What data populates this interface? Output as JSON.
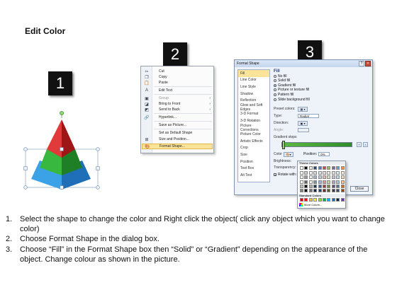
{
  "title": "Edit Color",
  "badges": [
    "1",
    "2",
    "3"
  ],
  "colors": {
    "pyramid_top": "#d42a2a",
    "pyramid_middle": "#2fa836",
    "pyramid_bottom": "#2f8fd6",
    "menu_highlight": "#fbe49a",
    "gradient_start": "#5db844",
    "gradient_end": "#2f8d2a"
  },
  "context_menu": {
    "items": [
      {
        "label": "Cut",
        "icon": "scissors-icon",
        "enabled": true
      },
      {
        "label": "Copy",
        "icon": "copy-icon",
        "enabled": true
      },
      {
        "label": "Paste",
        "icon": "paste-icon",
        "enabled": true
      },
      {
        "label": "Edit Text",
        "icon": "edit-text-icon",
        "enabled": true
      },
      {
        "label": "Group",
        "icon": "group-icon",
        "enabled": false,
        "submenu": true
      },
      {
        "label": "Bring to Front",
        "icon": "bring-front-icon",
        "enabled": true,
        "submenu": true
      },
      {
        "label": "Send to Back",
        "icon": "send-back-icon",
        "enabled": true,
        "submenu": true
      },
      {
        "label": "Hyperlink...",
        "icon": "hyperlink-icon",
        "enabled": true
      },
      {
        "label": "Save as Picture...",
        "icon": "",
        "enabled": true
      },
      {
        "label": "Set as Default Shape",
        "icon": "",
        "enabled": true
      },
      {
        "label": "Size and Position...",
        "icon": "size-position-icon",
        "enabled": true
      },
      {
        "label": "Format Shape...",
        "icon": "format-shape-icon",
        "enabled": true,
        "highlighted": true
      }
    ]
  },
  "dialog": {
    "title": "Format Shape",
    "help": "?",
    "close_glyph": "×",
    "categories": [
      "Fill",
      "Line Color",
      "Line Style",
      "Shadow",
      "Reflection",
      "Glow and Soft Edges",
      "3-D Format",
      "3-D Rotation",
      "Picture Corrections",
      "Picture Color",
      "Artistic Effects",
      "Crop",
      "Size",
      "Position",
      "Text Box",
      "Alt Text"
    ],
    "selected_category": "Fill",
    "heading": "Fill",
    "fill_options": [
      {
        "label": "No fill",
        "checked": false
      },
      {
        "label": "Solid fill",
        "checked": false
      },
      {
        "label": "Gradient fill",
        "checked": true
      },
      {
        "label": "Picture or texture fill",
        "checked": false
      },
      {
        "label": "Pattern fill",
        "checked": false
      },
      {
        "label": "Slide background fill",
        "checked": false
      }
    ],
    "preset_colors_label": "Preset colors:",
    "type_label": "Type:",
    "type_value": "Radial",
    "direction_label": "Direction:",
    "angle_label": "Angle:",
    "gradient_stops_label": "Gradient stops",
    "color_label": "Color",
    "position_label": "Position:",
    "position_value": "0%",
    "brightness_label": "Brightness:",
    "transparency_label": "Transparency:",
    "rotate_label": "Rotate with shape",
    "close_label": "Close"
  },
  "picker": {
    "theme_label": "Theme Colors",
    "standard_label": "Standard Colors",
    "more_label": "More Colors...",
    "theme_top": [
      "#ffffff",
      "#000000",
      "#eeece1",
      "#1f497d",
      "#4f81bd",
      "#c0504d",
      "#9bbb59",
      "#8064a2",
      "#4bacc6",
      "#f79646"
    ],
    "standard": [
      "#c00000",
      "#ff0000",
      "#ffc000",
      "#ffff00",
      "#92d050",
      "#00b050",
      "#00b0f0",
      "#0070c0",
      "#002060",
      "#7030a0"
    ]
  },
  "steps": [
    {
      "num": "1.",
      "text": "Select the shape to change the color and Right click the object( click any object which you want to change color)"
    },
    {
      "num": "2.",
      "text": "Choose Format Shape in the dialog box."
    },
    {
      "num": "3.",
      "text": "Choose “Fill” in the Format Shape box then “Solid” or “Gradient” depending on the appearance of the object. Change colour as shown in the picture."
    }
  ]
}
